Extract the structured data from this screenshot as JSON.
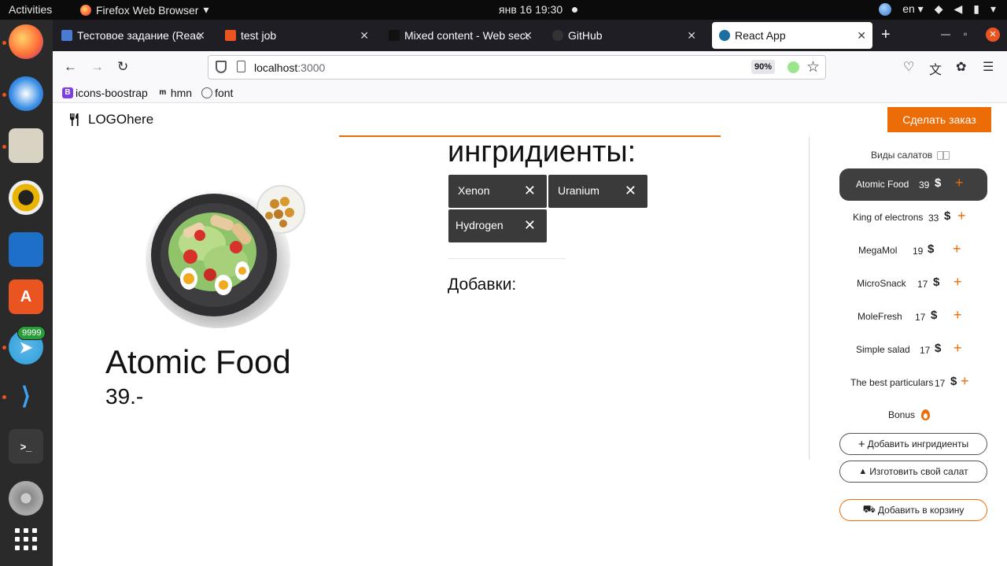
{
  "system_bar": {
    "activities": "Activities",
    "app_name": "Firefox Web Browser",
    "datetime": "янв 16  19:30",
    "language": "en"
  },
  "dock": {
    "notification_badge": "9999"
  },
  "browser": {
    "tabs": [
      {
        "title": "Тестовое задание (React",
        "icon_color": "#4a7bd0"
      },
      {
        "title": "test job",
        "icon_color": "#e95420"
      },
      {
        "title": "Mixed content - Web secu",
        "icon_color": "#111111"
      },
      {
        "title": "GitHub",
        "icon_color": "#333333"
      },
      {
        "title": "React App",
        "icon_color": "#1a6fa0"
      }
    ],
    "url_host": "localhost",
    "url_port": ":3000",
    "zoom": "90%",
    "bookmarks": [
      {
        "label": "icons-boostrap",
        "icon": "B",
        "icon_color": "#7b3fe4"
      },
      {
        "label": "hmn",
        "icon": "m",
        "icon_color": "#111111"
      },
      {
        "label": "font",
        "icon": "globe-icon",
        "icon_color": "#5b5b66"
      }
    ]
  },
  "page": {
    "logo_text": "LOGOhere",
    "order_button": "Сделать заказ",
    "dish_name": "Atomic Food",
    "dish_price": "39.-",
    "ingredients_heading": "ингридиенты:",
    "ingredients": [
      "Xenon",
      "Uranium",
      "Hydrogen"
    ],
    "addons_heading": "Добавки:",
    "types_heading": "Виды салатов",
    "currency_symbol": "$",
    "salads": [
      {
        "name": "Atomic Food",
        "price": "39"
      },
      {
        "name": "King of electrons",
        "price": "33"
      },
      {
        "name": "MegaMol",
        "price": "19"
      },
      {
        "name": "MicroSnack",
        "price": "17"
      },
      {
        "name": "MoleFresh",
        "price": "17"
      },
      {
        "name": "Simple salad",
        "price": "17"
      },
      {
        "name": "The best particulars",
        "price": "17"
      }
    ],
    "bonus_label": "Bonus",
    "add_ingredients_button": "Добавить ингридиенты",
    "make_salad_button": "Изготовить свой салат",
    "add_to_cart_button": "Добавить в корзину",
    "accent_color": "#ec6c08"
  }
}
